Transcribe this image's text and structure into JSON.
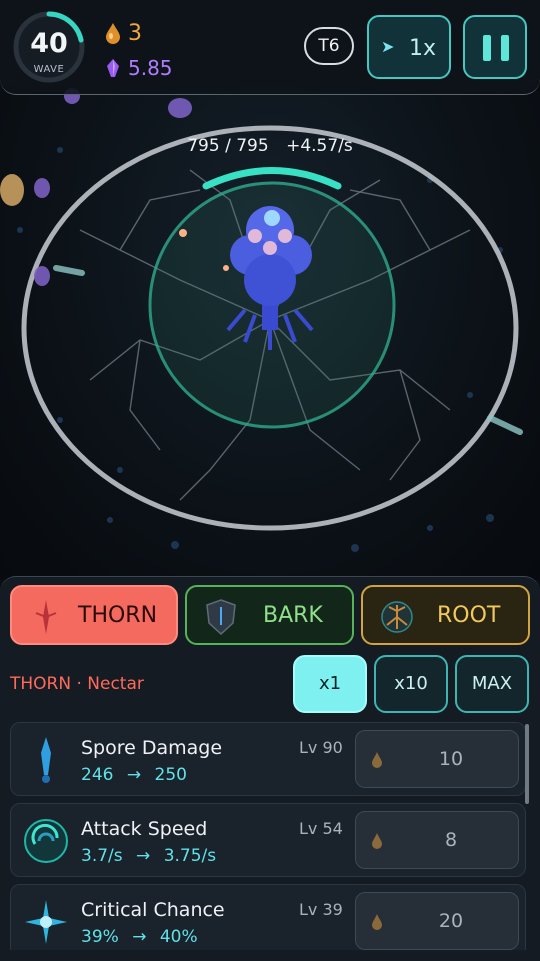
{
  "hud": {
    "wave_number": "40",
    "wave_label": "WAVE",
    "nectar": "3",
    "crystals": "5.85",
    "tier": "T6",
    "speed": "1x"
  },
  "tree": {
    "hp_text": "795 / 795",
    "regen_text": "+4.57/s",
    "hp_fraction": 1.0
  },
  "tabs": [
    {
      "label": "THORN",
      "icon": "thorn-icon",
      "selected": true
    },
    {
      "label": "BARK",
      "icon": "bark-shield-icon",
      "selected": false
    },
    {
      "label": "ROOT",
      "icon": "root-icon",
      "selected": false
    }
  ],
  "section": {
    "label": "THORN · Nectar"
  },
  "multipliers": [
    {
      "label": "x1",
      "selected": true
    },
    {
      "label": "x10",
      "selected": false
    },
    {
      "label": "MAX",
      "selected": false
    }
  ],
  "upgrades": [
    {
      "name": "Spore Damage",
      "level": "Lv 90",
      "current": "246",
      "next": "250",
      "cost": "10",
      "icon": "spore-dagger-icon"
    },
    {
      "name": "Attack Speed",
      "level": "Lv 54",
      "current": "3.7/s",
      "next": "3.75/s",
      "cost": "8",
      "icon": "swirl-icon"
    },
    {
      "name": "Critical Chance",
      "level": "Lv 39",
      "current": "39%",
      "next": "40%",
      "cost": "20",
      "icon": "spark-burst-icon"
    }
  ],
  "arrow": "→",
  "colors": {
    "accent_teal": "#48c6c0",
    "thorn": "#f46a5e",
    "bark": "#57b35a",
    "root": "#d3a340",
    "nectar": "#f0a640",
    "crystal": "#b07cff"
  }
}
